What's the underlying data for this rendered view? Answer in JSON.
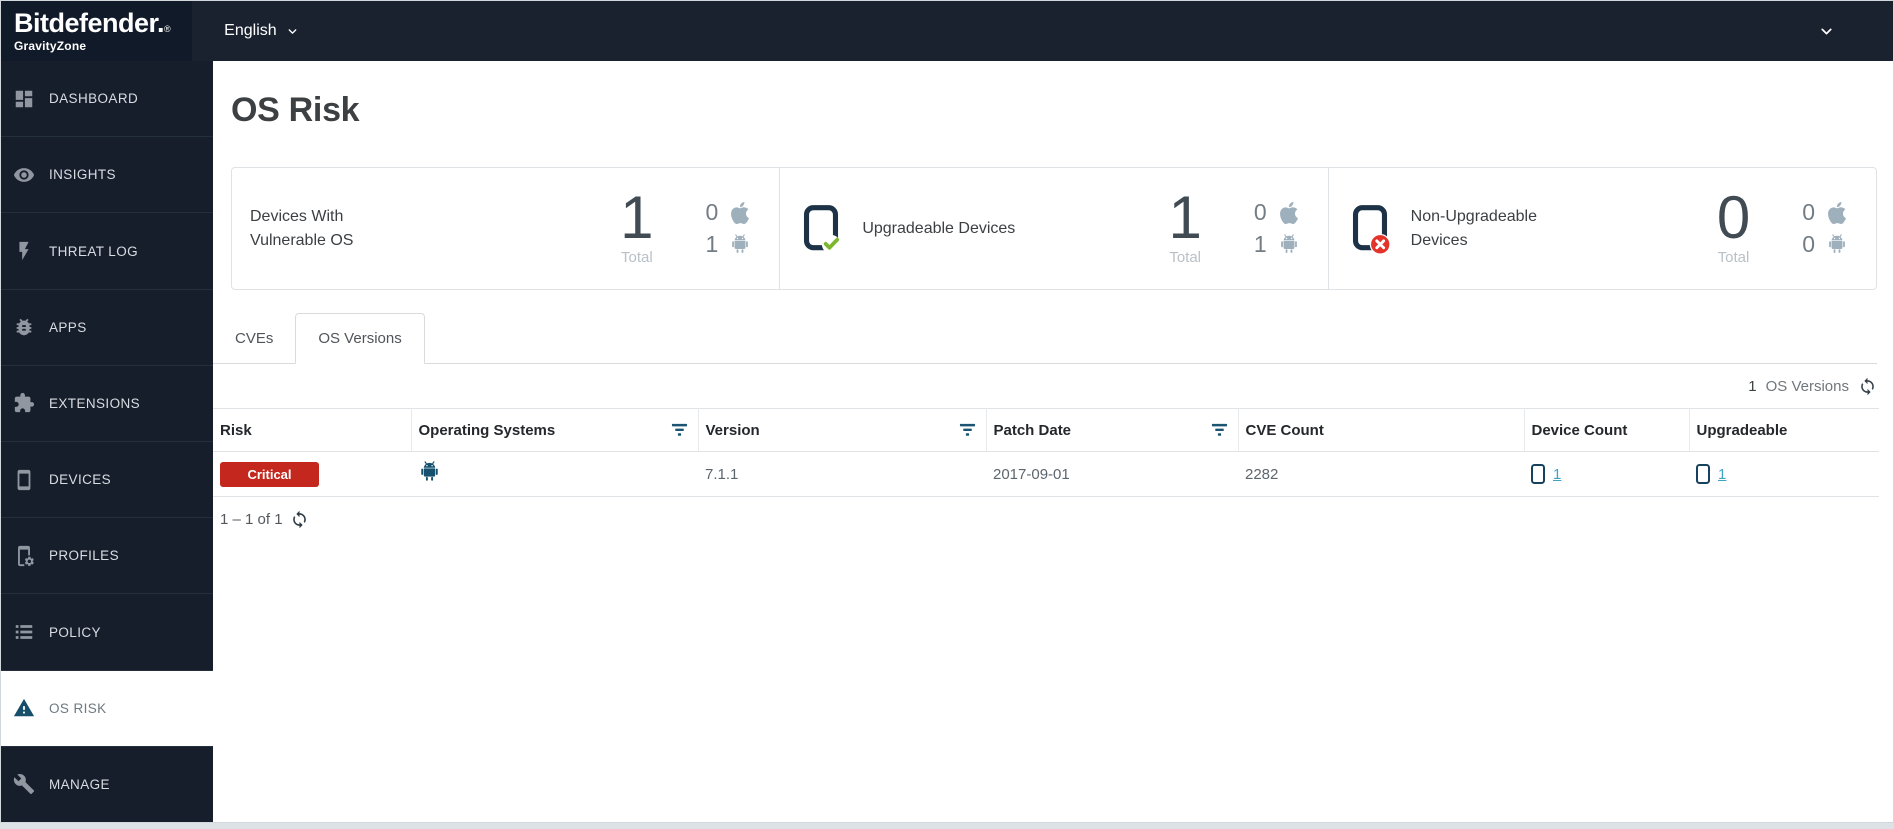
{
  "topbar": {
    "brand": "Bitdefender.",
    "reg_mark": "®",
    "product": "GravityZone",
    "language": "English"
  },
  "sidebar": {
    "items": [
      {
        "label": "DASHBOARD",
        "icon": "dashboard-icon",
        "active": false
      },
      {
        "label": "INSIGHTS",
        "icon": "eye-icon",
        "active": false
      },
      {
        "label": "THREAT LOG",
        "icon": "lightning-icon",
        "active": false
      },
      {
        "label": "APPS",
        "icon": "bug-icon",
        "active": false
      },
      {
        "label": "EXTENSIONS",
        "icon": "puzzle-icon",
        "active": false
      },
      {
        "label": "DEVICES",
        "icon": "smartphone-icon",
        "active": false
      },
      {
        "label": "PROFILES",
        "icon": "tablet-gear-icon",
        "active": false
      },
      {
        "label": "POLICY",
        "icon": "list-icon",
        "active": false
      },
      {
        "label": "OS RISK",
        "icon": "warning-triangle-icon",
        "active": true
      },
      {
        "label": "MANAGE",
        "icon": "wrench-icon",
        "active": false
      }
    ]
  },
  "page": {
    "title": "OS Risk"
  },
  "cards": [
    {
      "label": "Devices With Vulnerable OS",
      "icon": null,
      "total": "1",
      "total_label": "Total",
      "apple_count": "0",
      "android_count": "1"
    },
    {
      "label": "Upgradeable Devices",
      "icon": "tablet-check",
      "total": "1",
      "total_label": "Total",
      "apple_count": "0",
      "android_count": "1"
    },
    {
      "label": "Non-Upgradeable Devices",
      "icon": "tablet-x",
      "total": "0",
      "total_label": "Total",
      "apple_count": "0",
      "android_count": "0"
    }
  ],
  "tabs": [
    {
      "label": "CVEs",
      "active": false
    },
    {
      "label": "OS Versions",
      "active": true
    }
  ],
  "list_header": {
    "count": "1",
    "label": "OS Versions"
  },
  "table": {
    "columns": [
      {
        "label": "Risk",
        "filter": false
      },
      {
        "label": "Operating Systems",
        "filter": true
      },
      {
        "label": "Version",
        "filter": true
      },
      {
        "label": "Patch Date",
        "filter": true
      },
      {
        "label": "CVE Count",
        "filter": false
      },
      {
        "label": "Device Count",
        "filter": false
      },
      {
        "label": "Upgradeable",
        "filter": false
      }
    ],
    "rows": [
      {
        "risk": "Critical",
        "os": "android",
        "version": "7.1.1",
        "patch_date": "2017-09-01",
        "cve_count": "2282",
        "device_count": "1",
        "upgradeable_count": "1"
      }
    ]
  },
  "pagination": {
    "range": "1 – 1 of 1"
  },
  "colors": {
    "topbar_navy": "#1a2230",
    "sidebar_navy": "#161e2c",
    "critical_red": "#c3271e",
    "link_teal": "#3fa3c4",
    "success_green": "#7db72f",
    "error_red": "#e2342b",
    "icon_navy": "#15506e",
    "muted_icon_gray": "#9fb0bd"
  }
}
